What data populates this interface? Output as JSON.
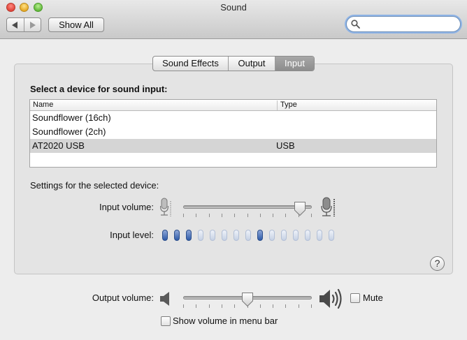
{
  "window": {
    "title": "Sound"
  },
  "toolbar": {
    "show_all_label": "Show All",
    "search_placeholder": ""
  },
  "tabs": [
    {
      "label": "Sound Effects",
      "selected": false
    },
    {
      "label": "Output",
      "selected": false
    },
    {
      "label": "Input",
      "selected": true
    }
  ],
  "input_panel": {
    "heading": "Select a device for sound input:",
    "columns": [
      "Name",
      "Type"
    ],
    "devices": [
      {
        "name": "Soundflower (16ch)",
        "type": "",
        "selected": false
      },
      {
        "name": "Soundflower (2ch)",
        "type": "",
        "selected": false
      },
      {
        "name": "AT2020 USB",
        "type": "USB",
        "selected": true
      }
    ],
    "settings_label": "Settings for the selected device:",
    "input_volume_label": "Input volume:",
    "input_volume_level": 0.95,
    "input_level_label": "Input level:",
    "input_level_pips": [
      1,
      1,
      1,
      0,
      0,
      0,
      0,
      0,
      1,
      0,
      0,
      0,
      0,
      0,
      0
    ],
    "help_label": "?"
  },
  "output": {
    "output_volume_label": "Output volume:",
    "output_volume_level": 0.5,
    "mute_label": "Mute",
    "mute_checked": false,
    "show_volume_label": "Show volume in menu bar",
    "show_volume_checked": false
  },
  "colors": {
    "selected_tab": "#999999",
    "level_on": "#2d5aa8",
    "level_off": "#c6d1e4",
    "search_focus": "#8fb4e6"
  }
}
